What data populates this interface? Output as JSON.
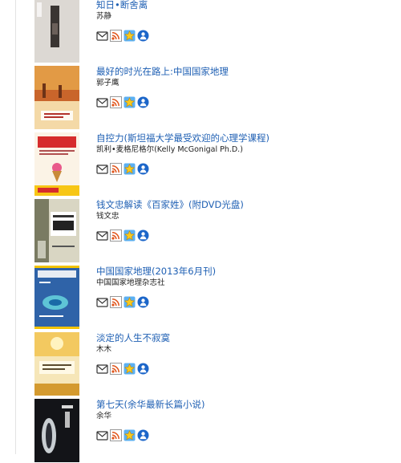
{
  "books": [
    {
      "title": "知日•断舍离",
      "author": "苏静",
      "cover": "#9b9590"
    },
    {
      "title": "最好的时光在路上:中国国家地理",
      "author": "郭子鹰",
      "cover": "#e29a45"
    },
    {
      "title": "自控力(斯坦福大学最受欢迎的心理学课程)",
      "author": "凯利•麦格尼格尔(Kelly McGonigal Ph.D.)",
      "cover": "#f3e3c6"
    },
    {
      "title": "钱文忠解读《百家姓》(附DVD光盘)",
      "author": "钱文忠",
      "cover": "#c9c4a8"
    },
    {
      "title": "中国国家地理(2013年6月刊)",
      "author": "中国国家地理杂志社",
      "cover": "#3a6fb4"
    },
    {
      "title": "淡定的人生不寂寞",
      "author": "木木",
      "cover": "#e9b649"
    },
    {
      "title": "第七天(余华最新长篇小说)",
      "author": "余华",
      "cover": "#131418"
    }
  ],
  "actions": [
    "envelope-icon",
    "rss-feed-icon",
    "star-icon",
    "user-icon"
  ],
  "colors": {
    "link": "#1e5fb3",
    "text": "#222222",
    "rss": "#e0541a",
    "star": "#f0b400",
    "user": "#1c66c9"
  }
}
